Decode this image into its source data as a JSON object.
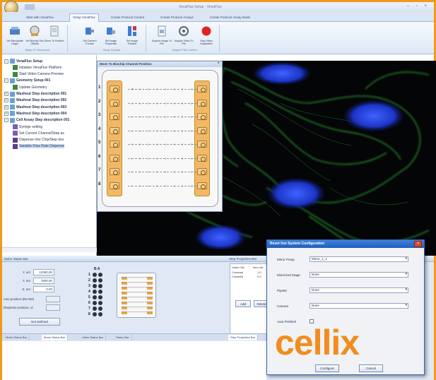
{
  "app": {
    "title": "VenaFlux Setup - VenaFlux",
    "quick_access": "",
    "window_controls": "– ▫ ×"
  },
  "ribbon_tabs": [
    {
      "label": "Start with VenaFlux"
    },
    {
      "label": "Setup VenaFlux"
    },
    {
      "label": "Create Protocol Control"
    },
    {
      "label": "Create Protocol Assays"
    },
    {
      "label": "Create Protocol Assay Mode"
    }
  ],
  "ribbon": {
    "buttons": [
      {
        "label": "Set Mirrorplate Origin",
        "icon": "stage-icon"
      },
      {
        "label": "Set Biochip Slot Offsets",
        "icon": "biochip-icon"
      },
      {
        "label": "Move To Position",
        "icon": "position-icon"
      },
      {
        "label": "Set Camera Format",
        "icon": "camera-icon"
      },
      {
        "label": "Set Image Properties",
        "icon": "image-icon"
      },
      {
        "label": "Set Image Position",
        "icon": "image-position-icon"
      },
      {
        "label": "Acquire Image To File",
        "icon": "acquire-image-icon"
      },
      {
        "label": "Acquire Video To File",
        "icon": "video-icon"
      },
      {
        "label": "Stop Video Acquisition",
        "icon": "stop-icon"
      }
    ],
    "groups": [
      {
        "label": "Setup XY Movement"
      },
      {
        "label": "Setup Camera"
      },
      {
        "label": "Acquire Files Control"
      }
    ]
  },
  "tree": {
    "nodes": [
      {
        "label": "VenaFlux Setup",
        "bold": true,
        "exp": "−",
        "depth": 0,
        "icon": "folder-icon",
        "color": "#6aa0d8"
      },
      {
        "label": "Initialize VenaFlux Platform",
        "bold": false,
        "exp": "",
        "depth": 2,
        "icon": "platform-icon",
        "color": "#3b8a3b"
      },
      {
        "label": "Start Video Camera Preview",
        "bold": false,
        "exp": "",
        "depth": 2,
        "icon": "camera-preview-icon",
        "color": "#3b8a3b"
      },
      {
        "label": "Geometry Setup 001",
        "bold": true,
        "exp": "−",
        "depth": 0,
        "icon": "folder-icon",
        "color": "#6aa0d8"
      },
      {
        "label": "Update Geometry",
        "bold": false,
        "exp": "",
        "depth": 2,
        "icon": "geometry-icon",
        "color": "#3b8a3b"
      },
      {
        "label": "Washout Step description 001",
        "bold": true,
        "exp": "+",
        "depth": 0,
        "icon": "folder-icon",
        "color": "#6aa0d8"
      },
      {
        "label": "Washout Step description 002",
        "bold": true,
        "exp": "+",
        "depth": 0,
        "icon": "folder-icon",
        "color": "#6aa0d8"
      },
      {
        "label": "Washout Step description 003",
        "bold": true,
        "exp": "+",
        "depth": 0,
        "icon": "folder-icon",
        "color": "#6aa0d8"
      },
      {
        "label": "Washout Step description 004",
        "bold": true,
        "exp": "+",
        "depth": 0,
        "icon": "folder-icon",
        "color": "#6aa0d8"
      },
      {
        "label": "Cell Assay Step description 001",
        "bold": true,
        "exp": "−",
        "depth": 0,
        "icon": "folder-icon",
        "color": "#6aa0d8"
      },
      {
        "label": "Syringe setting",
        "bold": false,
        "exp": "",
        "depth": 2,
        "icon": "syringe-icon",
        "color": "#7b5fb0"
      },
      {
        "label": "Set Current Channel/Step as",
        "bold": false,
        "exp": "",
        "depth": 2,
        "icon": "channel-icon",
        "color": "#7b5fb0"
      },
      {
        "label": "Dispense Into Chip/Step des",
        "bold": false,
        "exp": "",
        "depth": 2,
        "icon": "dispense-icon",
        "color": "#5a3e8c"
      },
      {
        "label": "Variable Flow Rate Dispense",
        "bold": false,
        "exp": "",
        "depth": 2,
        "icon": "flow-rate-icon",
        "color": "#5a3e8c",
        "selected": true
      }
    ]
  },
  "biochip_dialog": {
    "title": "Move To Biochip Channel Position",
    "channels": [
      "1",
      "2",
      "3",
      "4",
      "5",
      "6",
      "7",
      "8"
    ]
  },
  "motor_panel": {
    "header": "Motor Status Bar",
    "fields": [
      {
        "label": "Y, um",
        "value": "12380.00"
      },
      {
        "label": "Y, um",
        "value": "7600.00"
      },
      {
        "label": "Z, um",
        "value": "0.00"
      },
      {
        "label": "Axis position (B1+B2)",
        "value": ""
      },
      {
        "label": "Dispense position, ul",
        "value": ""
      }
    ],
    "button": "Not Defined",
    "grid_header": "B  A"
  },
  "step_panel": {
    "header": "Step Properties Bar",
    "column_a": "Under Val",
    "column_b": "Item Val",
    "rows": [
      {
        "a": "Constant",
        "b": "1.0"
      },
      {
        "a": "Constant",
        "b": "0.0"
      }
    ],
    "buttons": [
      "Add",
      "Delete"
    ]
  },
  "bottom_tabs": {
    "left": [
      "Motor Status Bar",
      "Motor Status Bar",
      "Video Status Bar",
      "Status Bar"
    ],
    "right": [
      "Step Properties Bar"
    ]
  },
  "reset_dialog": {
    "title": "Reset Xxx System Configuration",
    "fields": [
      {
        "label": "Mirror Pump",
        "value": "Mirror_1_1"
      },
      {
        "label": "Motorized Stage",
        "value": "None"
      },
      {
        "label": "Pipette",
        "value": "None"
      },
      {
        "label": "Camera",
        "value": "None"
      }
    ],
    "checkbox_label": "Auto Prefetch",
    "logo": "cellix",
    "buttons": [
      "Configure",
      "Cancel"
    ]
  },
  "colors": {
    "accent_border": "#ef9a1a",
    "logo": "#f28c1c",
    "dialog_titlebar": "#2a6cc8",
    "stop_button": "#e0241b"
  }
}
